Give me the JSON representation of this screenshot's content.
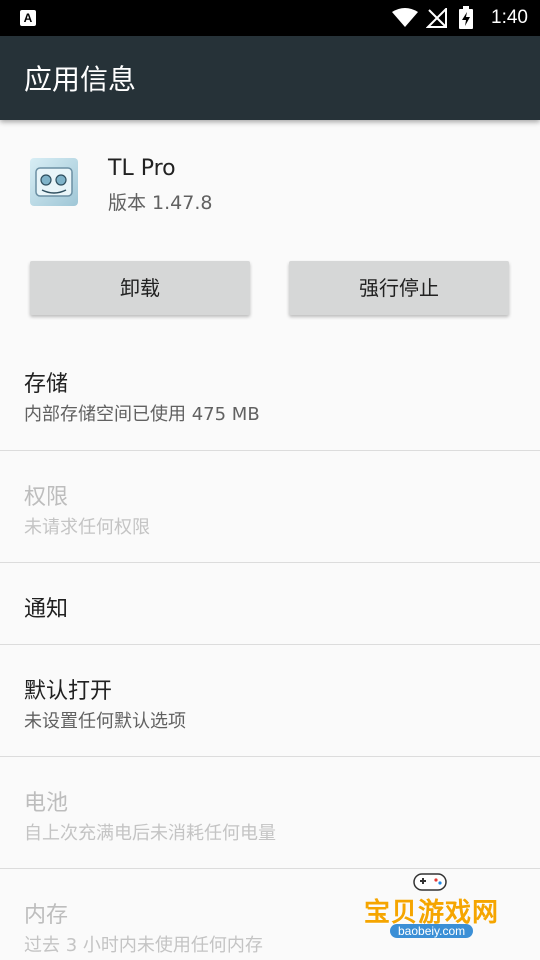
{
  "status_bar": {
    "time": "1:40",
    "notification_letter": "A"
  },
  "app_bar": {
    "title": "应用信息"
  },
  "app": {
    "name": "TL Pro",
    "version": "版本 1.47.8"
  },
  "buttons": {
    "uninstall": "卸载",
    "force_stop": "强行停止"
  },
  "sections": [
    {
      "title": "存储",
      "subtitle": "内部存储空间已使用 475 MB",
      "enabled": true
    },
    {
      "title": "权限",
      "subtitle": "未请求任何权限",
      "enabled": false
    },
    {
      "title": "通知",
      "subtitle": "",
      "enabled": true
    },
    {
      "title": "默认打开",
      "subtitle": "未设置任何默认选项",
      "enabled": true
    },
    {
      "title": "电池",
      "subtitle": "自上次充满电后未消耗任何电量",
      "enabled": false
    },
    {
      "title": "内存",
      "subtitle": "过去 3 小时内未使用任何内存",
      "enabled": false
    }
  ],
  "watermark": {
    "text": "宝贝游戏网",
    "url": "baobeiy.com"
  },
  "colors": {
    "app_bar": "#263238",
    "status_bar": "#000000",
    "button": "#d6d7d7",
    "background": "#fafafa"
  }
}
